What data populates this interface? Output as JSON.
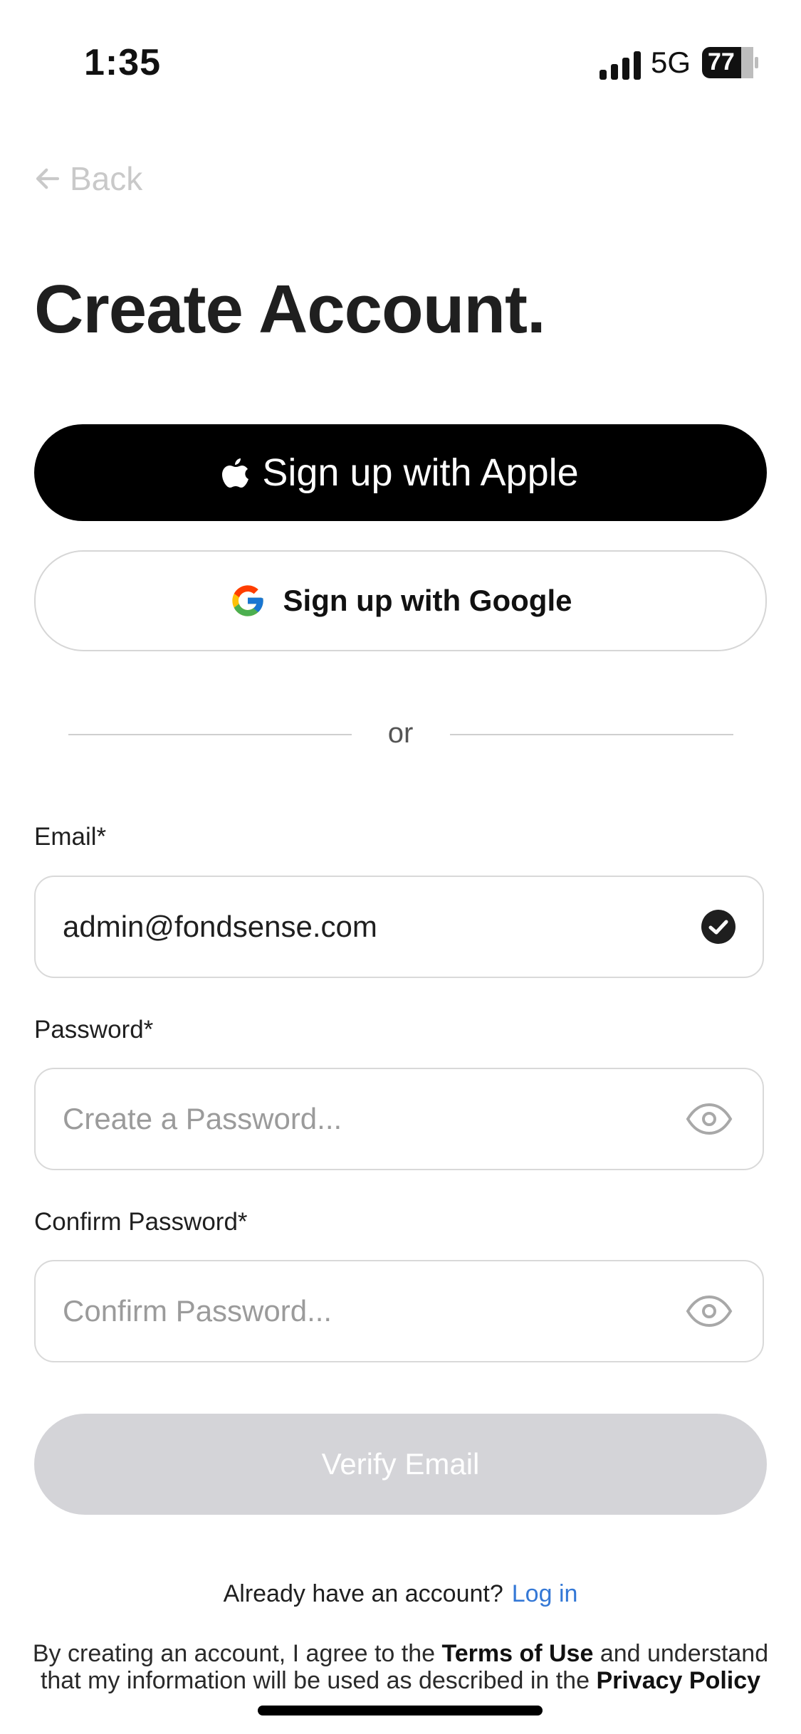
{
  "status_bar": {
    "time": "1:35",
    "network": "5G",
    "battery": "77"
  },
  "nav": {
    "back_label": "Back"
  },
  "page": {
    "title": "Create Account."
  },
  "social": {
    "apple_label": "Sign up with Apple",
    "google_label": "Sign up with Google"
  },
  "divider": {
    "label": "or"
  },
  "form": {
    "email": {
      "label": "Email*",
      "value": "admin@fondsense.com"
    },
    "password": {
      "label": "Password*",
      "placeholder": "Create a Password..."
    },
    "confirm": {
      "label": "Confirm Password*",
      "placeholder": "Confirm Password..."
    },
    "submit_label": "Verify Email"
  },
  "login_prompt": {
    "text": "Already have an account?",
    "link": "Log in"
  },
  "terms": {
    "part1": "By creating an account, I agree to the",
    "terms_link": "Terms of Use",
    "part2": "and understand that my information will be used as described in the",
    "privacy_link": "Privacy Policy"
  },
  "colors": {
    "link": "#3478d6",
    "primary": "#000000",
    "disabled": "#d4d4d8"
  }
}
